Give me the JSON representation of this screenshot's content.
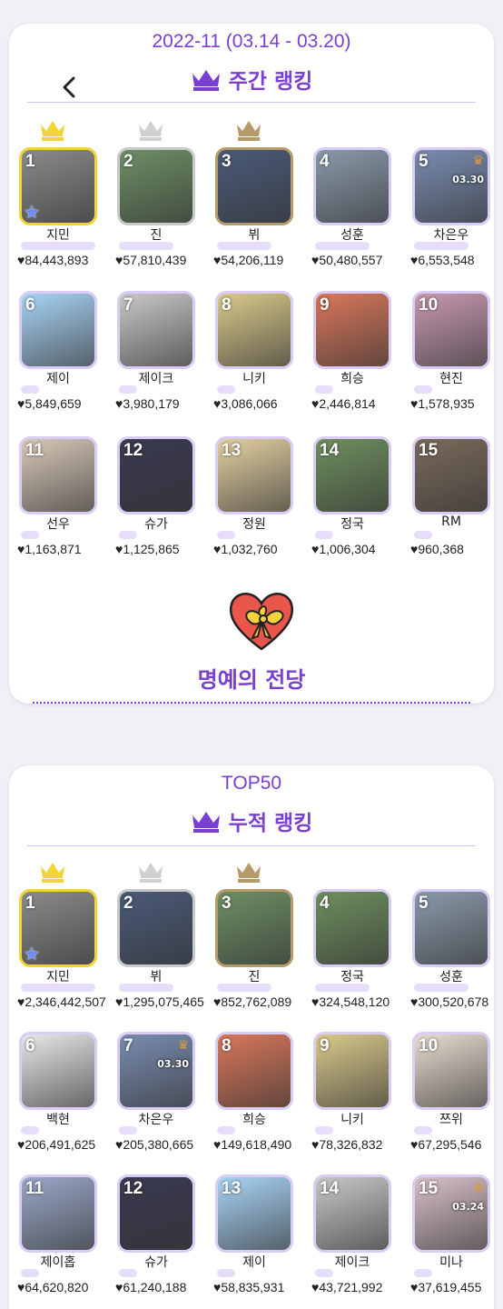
{
  "weekly": {
    "period": "2022-11 (03.14 - 03.20)",
    "ranking_label": "주간 랭킹",
    "items": [
      {
        "rank": "1",
        "name": "지민",
        "votes": "♥84,443,893",
        "bg": "#8b8b8b",
        "medal": "gold",
        "star": true
      },
      {
        "rank": "2",
        "name": "진",
        "votes": "♥57,810,439",
        "bg": "#6d8f64",
        "medal": "silver"
      },
      {
        "rank": "3",
        "name": "뷔",
        "votes": "♥54,206,119",
        "bg": "#4a5a78",
        "medal": "bronze"
      },
      {
        "rank": "4",
        "name": "성훈",
        "votes": "♥50,480,557",
        "bg": "#8a9aaa"
      },
      {
        "rank": "5",
        "name": "차은우",
        "votes": "♥6,553,548",
        "bg": "#7a8cb0",
        "date_tag": "03.30",
        "mini_crown": true
      },
      {
        "rank": "6",
        "name": "제이",
        "votes": "♥5,849,659",
        "bg": "#a8d4f5"
      },
      {
        "rank": "7",
        "name": "제이크",
        "votes": "♥3,980,179",
        "bg": "#c8c8c8"
      },
      {
        "rank": "8",
        "name": "니키",
        "votes": "♥3,086,066",
        "bg": "#d9c98a"
      },
      {
        "rank": "9",
        "name": "희승",
        "votes": "♥2,446,814",
        "bg": "#d9775a"
      },
      {
        "rank": "10",
        "name": "현진",
        "votes": "♥1,578,935",
        "bg": "#c79ab0"
      },
      {
        "rank": "11",
        "name": "선우",
        "votes": "♥1,163,871",
        "bg": "#d8c8b8"
      },
      {
        "rank": "12",
        "name": "슈가",
        "votes": "♥1,125,865",
        "bg": "#3a3a52"
      },
      {
        "rank": "13",
        "name": "정원",
        "votes": "♥1,032,760",
        "bg": "#e3cfa0"
      },
      {
        "rank": "14",
        "name": "정국",
        "votes": "♥1,006,304",
        "bg": "#6e8f5e"
      },
      {
        "rank": "15",
        "name": "RM",
        "votes": "♥960,368",
        "bg": "#7a6a5a"
      }
    ]
  },
  "hall_of_fame": {
    "label": "명예의 전당"
  },
  "cumulative": {
    "top_label": "TOP50",
    "ranking_label": "누적 랭킹",
    "items": [
      {
        "rank": "1",
        "name": "지민",
        "votes": "♥2,346,442,507",
        "bg": "#8b8b8b",
        "medal": "gold",
        "star": true
      },
      {
        "rank": "2",
        "name": "뷔",
        "votes": "♥1,295,075,465",
        "bg": "#4a5a78",
        "medal": "silver"
      },
      {
        "rank": "3",
        "name": "진",
        "votes": "♥852,762,089",
        "bg": "#6d8f64",
        "medal": "bronze"
      },
      {
        "rank": "4",
        "name": "정국",
        "votes": "♥324,548,120",
        "bg": "#6e8f5e"
      },
      {
        "rank": "5",
        "name": "성훈",
        "votes": "♥300,520,678",
        "bg": "#8a9aaa"
      },
      {
        "rank": "6",
        "name": "백현",
        "votes": "♥206,491,625",
        "bg": "#e8e8e8"
      },
      {
        "rank": "7",
        "name": "차은우",
        "votes": "♥205,380,665",
        "bg": "#7a8cb0",
        "date_tag": "03.30",
        "mini_crown": true
      },
      {
        "rank": "8",
        "name": "희승",
        "votes": "♥149,618,490",
        "bg": "#d9775a"
      },
      {
        "rank": "9",
        "name": "니키",
        "votes": "♥78,326,832",
        "bg": "#d9c98a"
      },
      {
        "rank": "10",
        "name": "쯔위",
        "votes": "♥67,295,546",
        "bg": "#e8dcd0"
      },
      {
        "rank": "11",
        "name": "제이홉",
        "votes": "♥64,620,820",
        "bg": "#9aa8c8"
      },
      {
        "rank": "12",
        "name": "슈가",
        "votes": "♥61,240,188",
        "bg": "#3a3a52"
      },
      {
        "rank": "13",
        "name": "제이",
        "votes": "♥58,835,931",
        "bg": "#a8d4f5"
      },
      {
        "rank": "14",
        "name": "제이크",
        "votes": "♥43,721,992",
        "bg": "#c8c8c8"
      },
      {
        "rank": "15",
        "name": "미나",
        "votes": "♥37,619,455",
        "bg": "#d8c0c8",
        "date_tag": "03.24",
        "mini_crown": true
      }
    ]
  },
  "colors": {
    "accent": "#7a3fd0",
    "gold": "#f0d23a",
    "silver": "#c9c9c9",
    "bronze": "#b59a6a"
  }
}
